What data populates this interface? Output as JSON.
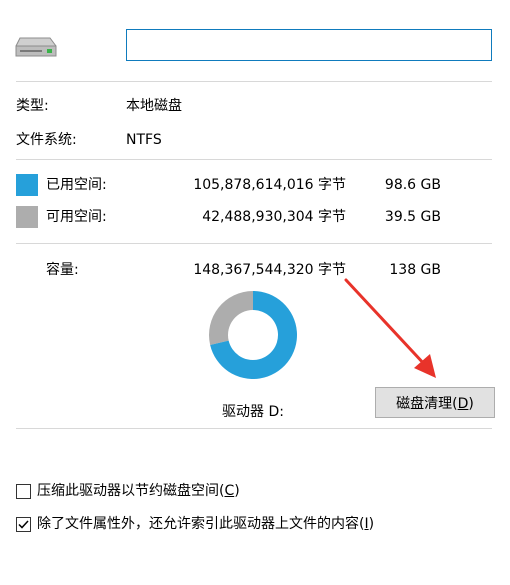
{
  "drive": {
    "name_value": "",
    "type_label": "类型:",
    "type_value": "本地磁盘",
    "fs_label": "文件系统:",
    "fs_value": "NTFS",
    "drive_label": "驱动器 D:"
  },
  "space": {
    "used": {
      "label": "已用空间:",
      "bytes": "105,878,614,016 字节",
      "size": "98.6 GB",
      "color": "#26a0da"
    },
    "free": {
      "label": "可用空间:",
      "bytes": "42,488,930,304 字节",
      "size": "39.5 GB",
      "color": "#adadad"
    },
    "capacity": {
      "label": "容量:",
      "bytes": "148,367,544,320 字节",
      "size": "138 GB"
    },
    "used_fraction": 0.7136
  },
  "buttons": {
    "disk_cleanup_prefix": "磁盘清理(",
    "disk_cleanup_key": "D",
    "disk_cleanup_suffix": ")"
  },
  "options": {
    "compress": {
      "prefix": "压缩此驱动器以节约磁盘空间(",
      "key": "C",
      "suffix": ")",
      "checked": false
    },
    "index": {
      "prefix": "除了文件属性外，还允许索引此驱动器上文件的内容(",
      "key": "I",
      "suffix": ")",
      "checked": true
    }
  },
  "annotation": {
    "arrow_color": "#e8332a"
  },
  "icons": {
    "drive": "hard-drive-icon",
    "checkmark": "checkmark-icon"
  }
}
